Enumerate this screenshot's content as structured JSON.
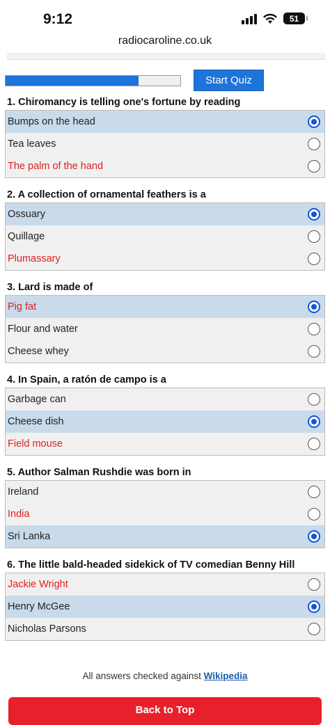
{
  "status_bar": {
    "time": "9:12",
    "battery": "51"
  },
  "browser": {
    "url": "radiocaroline.co.uk"
  },
  "quiz": {
    "progress": 0.76,
    "start_label": "Start Quiz",
    "questions": [
      {
        "title": "1. Chiromancy is telling one's fortune by reading",
        "options": [
          {
            "text": "Bumps on the head",
            "selected": true,
            "correct": false
          },
          {
            "text": "Tea leaves",
            "selected": false,
            "correct": false
          },
          {
            "text": "The palm of the hand",
            "selected": false,
            "correct": true
          }
        ]
      },
      {
        "title": "2. A collection of ornamental feathers is a",
        "options": [
          {
            "text": "Ossuary",
            "selected": true,
            "correct": false
          },
          {
            "text": "Quillage",
            "selected": false,
            "correct": false
          },
          {
            "text": "Plumassary",
            "selected": false,
            "correct": true
          }
        ]
      },
      {
        "title": "3. Lard is made of",
        "options": [
          {
            "text": "Pig fat",
            "selected": true,
            "correct": true
          },
          {
            "text": "Flour and water",
            "selected": false,
            "correct": false
          },
          {
            "text": "Cheese whey",
            "selected": false,
            "correct": false
          }
        ]
      },
      {
        "title": "4. In Spain, a ratón de campo is a",
        "options": [
          {
            "text": "Garbage can",
            "selected": false,
            "correct": false
          },
          {
            "text": "Cheese dish",
            "selected": true,
            "correct": false
          },
          {
            "text": "Field mouse",
            "selected": false,
            "correct": true
          }
        ]
      },
      {
        "title": "5. Author Salman Rushdie was born in",
        "options": [
          {
            "text": "Ireland",
            "selected": false,
            "correct": false
          },
          {
            "text": "India",
            "selected": false,
            "correct": true
          },
          {
            "text": "Sri Lanka",
            "selected": true,
            "correct": false
          }
        ]
      },
      {
        "title": "6. The little bald-headed sidekick of TV comedian Benny Hill",
        "options": [
          {
            "text": "Jackie Wright",
            "selected": false,
            "correct": true
          },
          {
            "text": "Henry McGee",
            "selected": true,
            "correct": false
          },
          {
            "text": "Nicholas Parsons",
            "selected": false,
            "correct": false
          }
        ]
      }
    ]
  },
  "footer": {
    "note_prefix": "All answers checked against ",
    "link_label": "Wikipedia",
    "back_to_top": "Back to Top"
  }
}
